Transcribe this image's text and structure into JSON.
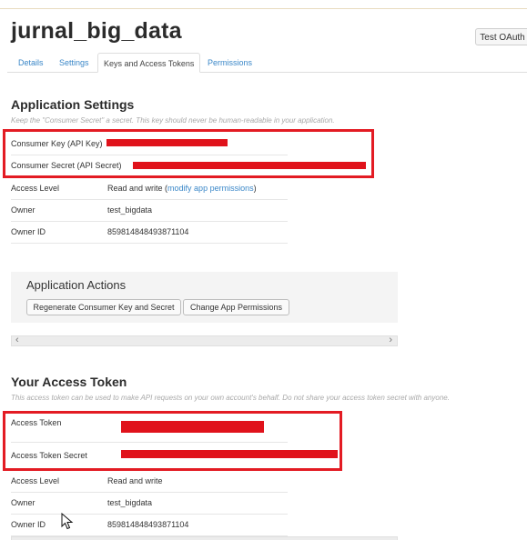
{
  "app": {
    "title": "jurnal_big_data",
    "test_oauth_label": "Test OAuth"
  },
  "tabs": [
    {
      "label": "Details"
    },
    {
      "label": "Settings"
    },
    {
      "label": "Keys and Access Tokens",
      "active": true
    },
    {
      "label": "Permissions"
    }
  ],
  "application_settings": {
    "title": "Application Settings",
    "hint": "Keep the \"Consumer Secret\" a secret. This key should never be human-readable in your application.",
    "consumer_key_label": "Consumer Key (API Key)",
    "consumer_secret_label": "Consumer Secret (API Secret)",
    "access_level_label": "Access Level",
    "access_level_value": "Read and write",
    "modify_link": "modify app permissions",
    "owner_label": "Owner",
    "owner_value": "test_bigdata",
    "owner_id_label": "Owner ID",
    "owner_id_value": "859814848493871104"
  },
  "application_actions": {
    "title": "Application Actions",
    "regenerate_button": "Regenerate Consumer Key and Secret",
    "change_permissions_button": "Change App Permissions"
  },
  "access_token": {
    "title": "Your Access Token",
    "hint": "This access token can be used to make API requests on your own account's behalf. Do not share your access token secret with anyone.",
    "access_token_label": "Access Token",
    "access_token_secret_label": "Access Token Secret",
    "access_level_label": "Access Level",
    "access_level_value": "Read and write",
    "owner_label": "Owner",
    "owner_value": "test_bigdata",
    "owner_id_label": "Owner ID",
    "owner_id_value": "859814848493871104"
  },
  "colors": {
    "link": "#3a87c8",
    "redaction": "#e0121b",
    "highlight_box": "#e31b23"
  },
  "icons": {
    "scroll_left": "chevron-left-icon",
    "scroll_right": "chevron-right-icon",
    "pointer": "mouse-cursor-icon"
  }
}
